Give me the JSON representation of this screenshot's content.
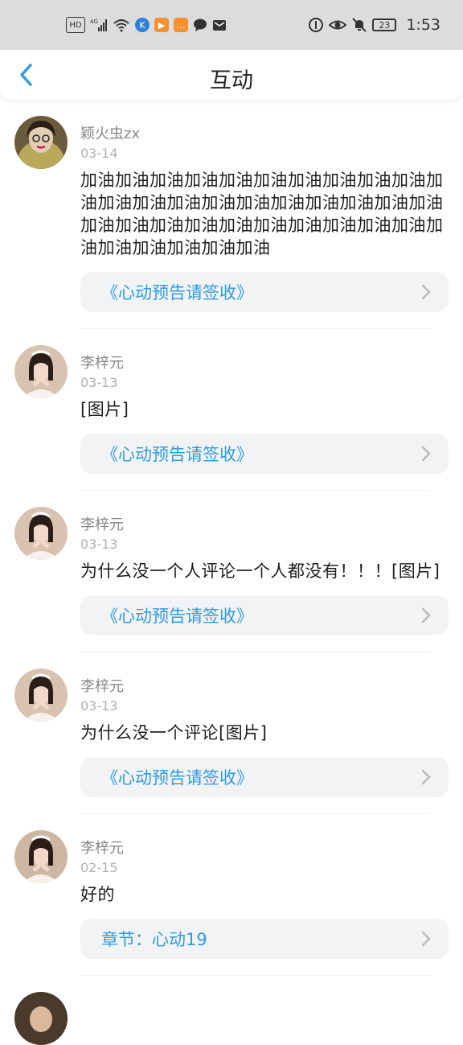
{
  "statusbar": {
    "left_icons": [
      "hd-icon",
      "signal-4g-icon",
      "wifi-icon",
      "app-k-icon",
      "app-play-icon",
      "app-chat-icon",
      "message-icon",
      "mail-icon"
    ],
    "battery": "23",
    "time": "1:53"
  },
  "header": {
    "title": "互动"
  },
  "colors": {
    "accent": "#2f9ce0",
    "status_bar": "#dcdcdc"
  },
  "items": [
    {
      "username": "颖火虫zx",
      "date": "03-14",
      "content": "加油加油加油加油加油加油加油加油加油加油加油加油加油加油加油加油加油加油加油加油加油加油加油加油加油加油加油加油加油加油加油加油加油加油加油加油加油",
      "link": "《心动预告请签收》"
    },
    {
      "username": "李梓元",
      "date": "03-13",
      "content": "[图片]",
      "link": "《心动预告请签收》"
    },
    {
      "username": "李梓元",
      "date": "03-13",
      "content": "为什么没一个人评论一个人都没有！！！[图片]",
      "link": "《心动预告请签收》"
    },
    {
      "username": "李梓元",
      "date": "03-13",
      "content": "为什么没一个评论[图片]",
      "link": "《心动预告请签收》"
    },
    {
      "username": "李梓元",
      "date": "02-15",
      "content": "好的",
      "link": "章节：心动19"
    }
  ]
}
